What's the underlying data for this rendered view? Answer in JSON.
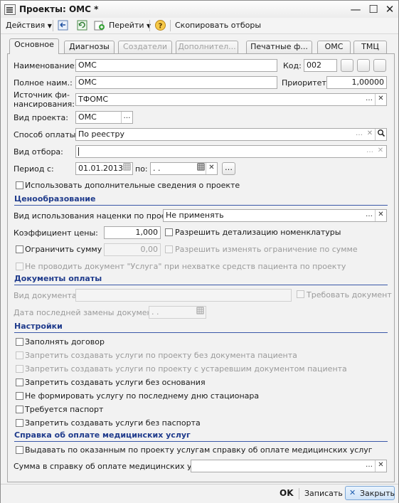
{
  "window": {
    "title": "Проекты: ОМС *"
  },
  "toolbar": {
    "actions_label": "Действия",
    "goto_label": "Перейти",
    "copy_filters_label": "Скопировать отборы",
    "help_label": "?"
  },
  "tabs": [
    {
      "label": "Основное"
    },
    {
      "label": "Диагнозы"
    },
    {
      "label": "Создатели"
    },
    {
      "label": "Дополнител..."
    },
    {
      "label": "Печатные ф..."
    },
    {
      "label": "ОМС"
    },
    {
      "label": "ТМЦ"
    }
  ],
  "form": {
    "name_label": "Наименование:",
    "name_value": "ОМС",
    "code_label": "Код:",
    "code_value": "002",
    "fullname_label": "Полное наим.:",
    "fullname_value": "ОМС",
    "priority_label": "Приоритет:",
    "priority_value": "1,00000",
    "source_label": "Источник фи-\nнансирования:",
    "source_value": "ТФОМС",
    "project_type_label": "Вид проекта:",
    "project_type_value": "ОМС",
    "payment_label": "Способ оплаты:",
    "payment_value": "По реестру",
    "selection_label": "Вид отбора:",
    "selection_value": "",
    "period_label": "Период с:",
    "period_from": "01.01.2013",
    "period_to_label": "по:",
    "period_to": " .  .",
    "extra_info_label": "Использовать дополнительные сведения о проекте"
  },
  "pricing": {
    "section_title": "Ценообразование",
    "markup_label": "Вид использования наценки по проекту:",
    "markup_value": "Не применять",
    "coef_label": "Коэффициент цены:",
    "coef_value": "1,000",
    "detail_label": "Разрешить детализацию номенклатуры",
    "limit_label": "Ограничить сумму",
    "limit_value": "0,00",
    "allow_change_label": "Разрешить изменять ограничение по сумме",
    "no_service_label": "Не проводить документ \"Услуга\" при нехватке средств пациента по проекту"
  },
  "payment_docs": {
    "section_title": "Документы оплаты",
    "doc_type_label": "Вид документа:",
    "doc_type_value": "",
    "require_doc_label": "Требовать документ",
    "last_replace_label": "Дата последней замены документа:",
    "last_replace_value": " .  ."
  },
  "settings": {
    "section_title": "Настройки",
    "items": [
      {
        "label": "Заполнять договор",
        "disabled": false
      },
      {
        "label": "Запретить создавать услуги по проекту без документа пациента",
        "disabled": true
      },
      {
        "label": "Запретить создавать услуги по проекту с устаревшим документом пациента",
        "disabled": true
      },
      {
        "label": "Запретить создавать услуги без основания",
        "disabled": false
      },
      {
        "label": "Не формировать услугу по последнему дню стационара",
        "disabled": false
      },
      {
        "label": "Требуется паспорт",
        "disabled": false
      },
      {
        "label": "Запретить создавать услуги без паспорта",
        "disabled": false
      }
    ]
  },
  "certificate": {
    "section_title": "Справка об оплате медицинских услуг",
    "issue_label": "Выдавать по оказанным по проекту услугам справку об оплате медицинских услуг",
    "sum_label": "Сумма в справку об оплате медицинских услуг:",
    "sum_value": ""
  },
  "footer": {
    "ok_label": "OK",
    "save_label": "Записать",
    "close_label": "Закрыть"
  }
}
